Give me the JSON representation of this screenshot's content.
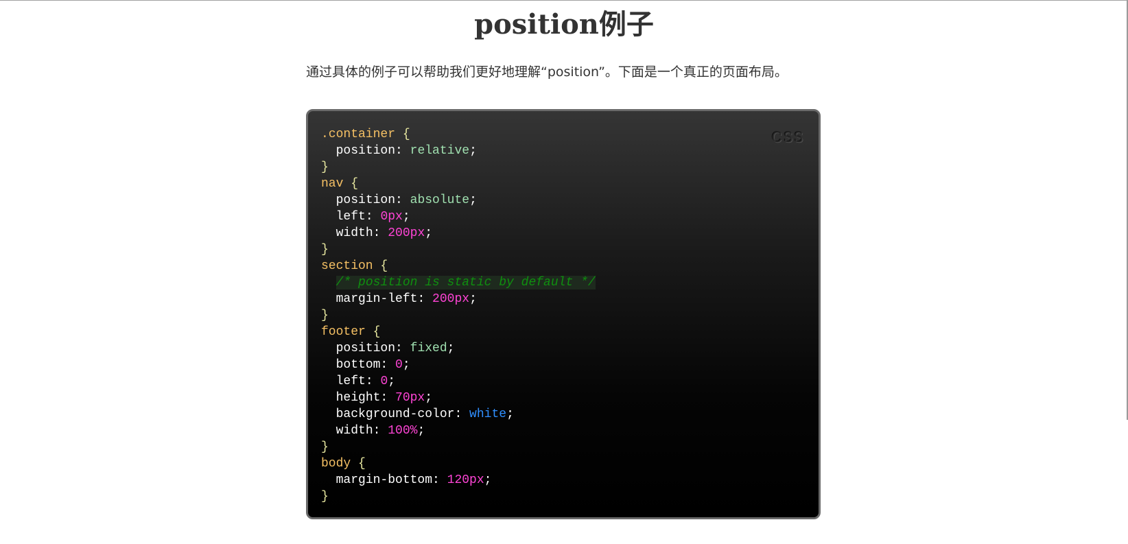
{
  "page": {
    "title": "position例子",
    "intro": "通过具体的例子可以帮助我们更好地理解“position”。下面是一个真正的页面布局。"
  },
  "code_block": {
    "language": "CSS",
    "lines": [
      {
        "indent": 0,
        "tokens": [
          {
            "t": ".container",
            "k": "sel"
          },
          {
            "t": " {",
            "k": "brace"
          }
        ]
      },
      {
        "indent": 1,
        "tokens": [
          {
            "t": "position",
            "k": "prop"
          },
          {
            "t": ": ",
            "k": "punct"
          },
          {
            "t": "relative",
            "k": "kw"
          },
          {
            "t": ";",
            "k": "punct"
          }
        ]
      },
      {
        "indent": 0,
        "tokens": [
          {
            "t": "}",
            "k": "brace"
          }
        ]
      },
      {
        "indent": 0,
        "tokens": [
          {
            "t": "nav",
            "k": "sel"
          },
          {
            "t": " {",
            "k": "brace"
          }
        ]
      },
      {
        "indent": 1,
        "tokens": [
          {
            "t": "position",
            "k": "prop"
          },
          {
            "t": ": ",
            "k": "punct"
          },
          {
            "t": "absolute",
            "k": "kw"
          },
          {
            "t": ";",
            "k": "punct"
          }
        ]
      },
      {
        "indent": 1,
        "tokens": [
          {
            "t": "left",
            "k": "prop"
          },
          {
            "t": ": ",
            "k": "punct"
          },
          {
            "t": "0px",
            "k": "num"
          },
          {
            "t": ";",
            "k": "punct"
          }
        ]
      },
      {
        "indent": 1,
        "tokens": [
          {
            "t": "width",
            "k": "prop"
          },
          {
            "t": ": ",
            "k": "punct"
          },
          {
            "t": "200px",
            "k": "num"
          },
          {
            "t": ";",
            "k": "punct"
          }
        ]
      },
      {
        "indent": 0,
        "tokens": [
          {
            "t": "}",
            "k": "brace"
          }
        ]
      },
      {
        "indent": 0,
        "tokens": [
          {
            "t": "section",
            "k": "sel"
          },
          {
            "t": " {",
            "k": "brace"
          }
        ]
      },
      {
        "indent": 1,
        "tokens": [
          {
            "t": "/* position is static by default */",
            "k": "comment"
          }
        ]
      },
      {
        "indent": 1,
        "tokens": [
          {
            "t": "margin-left",
            "k": "prop"
          },
          {
            "t": ": ",
            "k": "punct"
          },
          {
            "t": "200px",
            "k": "num"
          },
          {
            "t": ";",
            "k": "punct"
          }
        ]
      },
      {
        "indent": 0,
        "tokens": [
          {
            "t": "}",
            "k": "brace"
          }
        ]
      },
      {
        "indent": 0,
        "tokens": [
          {
            "t": "footer",
            "k": "sel"
          },
          {
            "t": " {",
            "k": "brace"
          }
        ]
      },
      {
        "indent": 1,
        "tokens": [
          {
            "t": "position",
            "k": "prop"
          },
          {
            "t": ": ",
            "k": "punct"
          },
          {
            "t": "fixed",
            "k": "kw"
          },
          {
            "t": ";",
            "k": "punct"
          }
        ]
      },
      {
        "indent": 1,
        "tokens": [
          {
            "t": "bottom",
            "k": "prop"
          },
          {
            "t": ": ",
            "k": "punct"
          },
          {
            "t": "0",
            "k": "num"
          },
          {
            "t": ";",
            "k": "punct"
          }
        ]
      },
      {
        "indent": 1,
        "tokens": [
          {
            "t": "left",
            "k": "prop"
          },
          {
            "t": ": ",
            "k": "punct"
          },
          {
            "t": "0",
            "k": "num"
          },
          {
            "t": ";",
            "k": "punct"
          }
        ]
      },
      {
        "indent": 1,
        "tokens": [
          {
            "t": "height",
            "k": "prop"
          },
          {
            "t": ": ",
            "k": "punct"
          },
          {
            "t": "70px",
            "k": "num"
          },
          {
            "t": ";",
            "k": "punct"
          }
        ]
      },
      {
        "indent": 1,
        "tokens": [
          {
            "t": "background-color",
            "k": "prop"
          },
          {
            "t": ": ",
            "k": "punct"
          },
          {
            "t": "white",
            "k": "color"
          },
          {
            "t": ";",
            "k": "punct"
          }
        ]
      },
      {
        "indent": 1,
        "tokens": [
          {
            "t": "width",
            "k": "prop"
          },
          {
            "t": ": ",
            "k": "punct"
          },
          {
            "t": "100%",
            "k": "num"
          },
          {
            "t": ";",
            "k": "punct"
          }
        ]
      },
      {
        "indent": 0,
        "tokens": [
          {
            "t": "}",
            "k": "brace"
          }
        ]
      },
      {
        "indent": 0,
        "tokens": [
          {
            "t": "body",
            "k": "sel"
          },
          {
            "t": " {",
            "k": "brace"
          }
        ]
      },
      {
        "indent": 1,
        "tokens": [
          {
            "t": "margin-bottom",
            "k": "prop"
          },
          {
            "t": ": ",
            "k": "punct"
          },
          {
            "t": "120px",
            "k": "num"
          },
          {
            "t": ";",
            "k": "punct"
          }
        ]
      },
      {
        "indent": 0,
        "tokens": [
          {
            "t": "}",
            "k": "brace"
          }
        ]
      }
    ]
  },
  "colors": {
    "selector": "#f5c064",
    "keyword_value": "#a0e0b0",
    "number_value": "#ff44d6",
    "color_value": "#2f8fff",
    "comment": "#0f8f0f",
    "code_background": "#000000"
  }
}
